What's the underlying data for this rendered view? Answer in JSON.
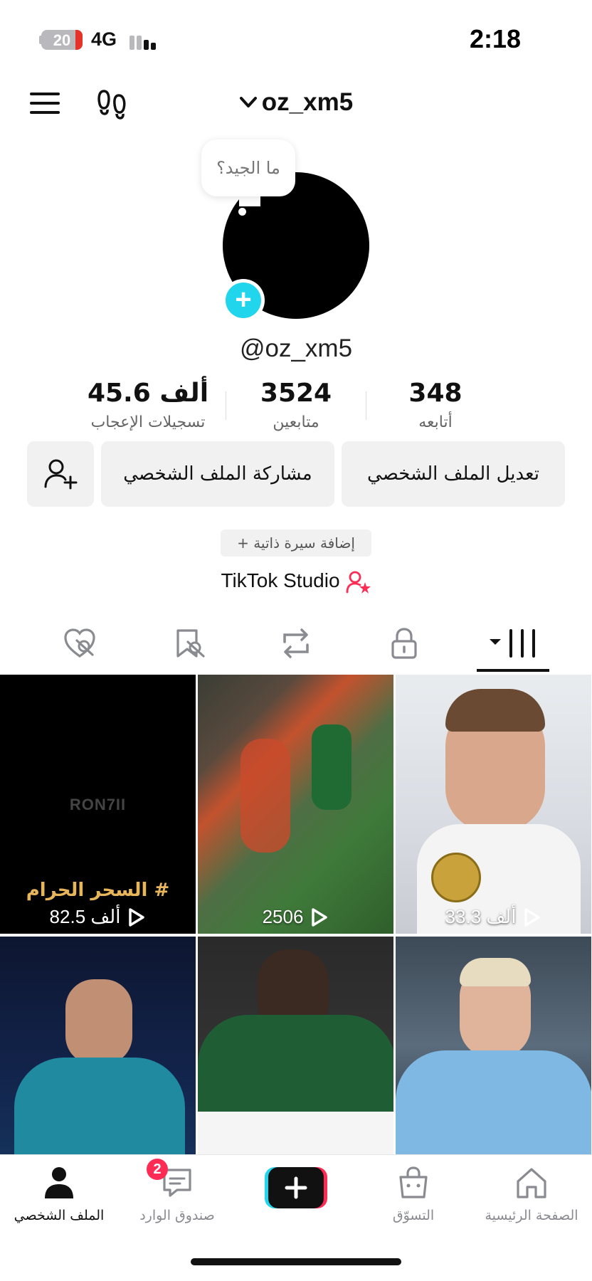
{
  "status_bar": {
    "battery": "20",
    "network": "4G",
    "time": "2:18"
  },
  "header": {
    "username": "oz_xm5"
  },
  "avatar": {
    "bubble_text": "ما الجيد؟"
  },
  "profile": {
    "handle": "@oz_xm5"
  },
  "stats": [
    {
      "value": "45.6 ألف",
      "label": "تسجيلات الإعجاب"
    },
    {
      "value": "3524",
      "label": "متابعين"
    },
    {
      "value": "348",
      "label": "أتابعه"
    }
  ],
  "buttons": {
    "share": "مشاركة الملف الشخصي",
    "edit": "تعديل الملف الشخصي"
  },
  "bio_button": "+ إضافة سيرة ذاتية",
  "studio_link": "TikTok Studio",
  "tabs": [
    "liked-hidden-icon",
    "favorites-hidden-icon",
    "repost-icon",
    "lock-icon",
    "videos-grid-icon"
  ],
  "videos": [
    {
      "views": "82.5 ألف",
      "caption": "السحر الحرام #",
      "watermark": "RON7II"
    },
    {
      "views": "2506"
    },
    {
      "views": "33.3 ألف"
    },
    {},
    {},
    {}
  ],
  "bottom_nav": {
    "profile": "الملف الشخصي",
    "inbox": "صندوق الوارد",
    "inbox_badge": "2",
    "shop": "التسوّق",
    "home": "الصفحة الرئيسية"
  },
  "colors": {
    "accent_cyan": "#20d5ec",
    "accent_pink": "#fe2c55",
    "studio_icon": "#fe2c55"
  }
}
